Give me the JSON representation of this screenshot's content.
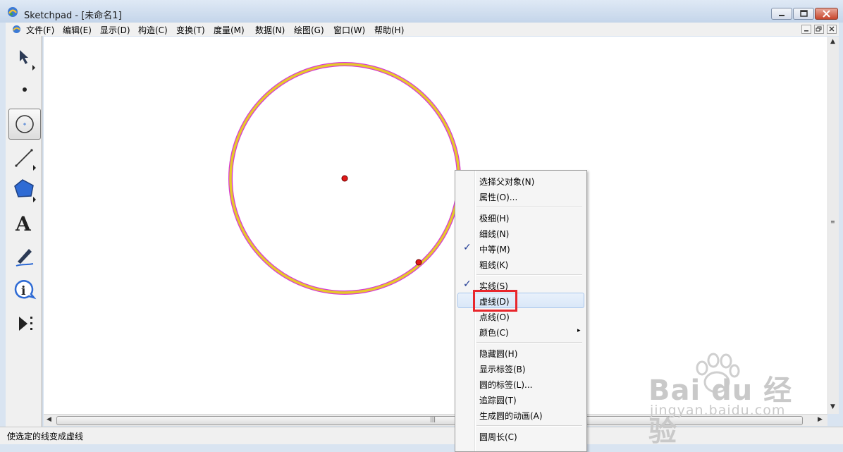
{
  "window": {
    "title": "Sketchpad  - [未命名1]"
  },
  "menubar": {
    "items": [
      {
        "label": "文件(F)"
      },
      {
        "label": "编辑(E)"
      },
      {
        "label": "显示(D)"
      },
      {
        "label": "构造(C)"
      },
      {
        "label": "变换(T)"
      },
      {
        "label": "度量(M)"
      },
      {
        "label": "数据(N)"
      },
      {
        "label": "绘图(G)"
      },
      {
        "label": "窗口(W)"
      },
      {
        "label": "帮助(H)"
      }
    ]
  },
  "toolbox": {
    "tools": [
      {
        "name": "arrow-tool-icon"
      },
      {
        "name": "point-tool-icon"
      },
      {
        "name": "compass-tool-icon",
        "selected": true
      },
      {
        "name": "straightedge-tool-icon"
      },
      {
        "name": "polygon-tool-icon"
      },
      {
        "name": "text-tool-icon",
        "glyph": "A"
      },
      {
        "name": "marker-tool-icon"
      },
      {
        "name": "information-tool-icon"
      },
      {
        "name": "custom-tool-icon"
      }
    ]
  },
  "canvas": {
    "circle_stroke_color": "#e6c82a",
    "selection_color": "#d63ad6",
    "point_color": "#e01818"
  },
  "context_menu": {
    "groups": [
      [
        {
          "label": "选择父对象(N)"
        },
        {
          "label": "属性(O)..."
        }
      ],
      [
        {
          "label": "极细(H)"
        },
        {
          "label": "细线(N)"
        },
        {
          "label": "中等(M)",
          "checked": true
        },
        {
          "label": "粗线(K)"
        }
      ],
      [
        {
          "label": "实线(S)",
          "checked": true
        },
        {
          "label": "虚线(D)",
          "hovered": true
        },
        {
          "label": "点线(O)"
        },
        {
          "label": "颜色(C)",
          "submenu": true
        }
      ],
      [
        {
          "label": "隐藏圆(H)"
        },
        {
          "label": "显示标签(B)"
        },
        {
          "label": "圆的标签(L)..."
        },
        {
          "label": "追踪圆(T)"
        },
        {
          "label": "生成圆的动画(A)"
        }
      ],
      [
        {
          "label": "圆周长(C)"
        }
      ]
    ],
    "check_glyph": "✓",
    "submenu_glyph": "▸"
  },
  "statusbar": {
    "text": "使选定的线变成虚线"
  },
  "watermark": {
    "logo": "Bai du 经验",
    "url": "jingyan.baidu.com"
  }
}
